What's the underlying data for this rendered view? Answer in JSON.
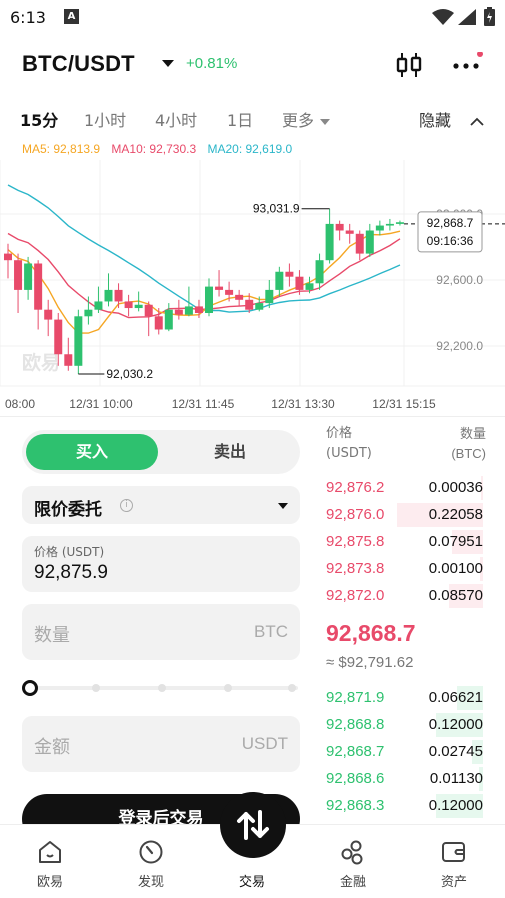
{
  "status_bar": {
    "time": "6:13",
    "app_badge": "A"
  },
  "header": {
    "pair": "BTC/USDT",
    "change": "+0.81%",
    "change_color": "#2ec16f"
  },
  "tabs": {
    "items": [
      "15分",
      "1小时",
      "4小时",
      "1日",
      "更多"
    ],
    "active": "15分",
    "hide_label": "隐藏"
  },
  "ma": {
    "ma5": "MA5: 92,813.9",
    "ma10": "MA10: 92,730.3",
    "ma20": "MA20: 92,619.0",
    "colors": {
      "ma5": "#f5a623",
      "ma10": "#e84a6a",
      "ma20": "#2bb6c9"
    }
  },
  "chart_data": {
    "type": "candlestick",
    "y_ticks": [
      "93,000.0",
      "92,600.0",
      "92,200.0"
    ],
    "x_ticks": [
      "08:00",
      "12/31 10:00",
      "12/31 11:45",
      "12/31 13:30",
      "12/31 15:15"
    ],
    "high_label": "93,031.9",
    "low_label": "92,030.2",
    "current_price": "92,868.7",
    "countdown": "09:16:36",
    "watermark": "欧易",
    "candles": [
      [
        92760,
        92720,
        92820,
        92610
      ],
      [
        92720,
        92540,
        92760,
        92400
      ],
      [
        92540,
        92700,
        92740,
        92480
      ],
      [
        92700,
        92420,
        92720,
        92300
      ],
      [
        92420,
        92360,
        92480,
        92260
      ],
      [
        92360,
        92150,
        92400,
        92080
      ],
      [
        92150,
        92080,
        92250,
        92050
      ],
      [
        92080,
        92380,
        92420,
        92030
      ],
      [
        92380,
        92420,
        92500,
        92330
      ],
      [
        92420,
        92470,
        92560,
        92400
      ],
      [
        92470,
        92540,
        92640,
        92440
      ],
      [
        92540,
        92470,
        92580,
        92430
      ],
      [
        92470,
        92430,
        92510,
        92380
      ],
      [
        92430,
        92450,
        92530,
        92410
      ],
      [
        92450,
        92380,
        92470,
        92260
      ],
      [
        92380,
        92300,
        92430,
        92270
      ],
      [
        92300,
        92420,
        92460,
        92290
      ],
      [
        92420,
        92390,
        92480,
        92360
      ],
      [
        92390,
        92440,
        92560,
        92380
      ],
      [
        92440,
        92400,
        92480,
        92370
      ],
      [
        92400,
        92560,
        92610,
        92380
      ],
      [
        92560,
        92540,
        92660,
        92500
      ],
      [
        92540,
        92510,
        92590,
        92470
      ],
      [
        92510,
        92480,
        92540,
        92440
      ],
      [
        92480,
        92420,
        92520,
        92400
      ],
      [
        92420,
        92460,
        92500,
        92410
      ],
      [
        92460,
        92540,
        92600,
        92430
      ],
      [
        92540,
        92650,
        92680,
        92500
      ],
      [
        92650,
        92620,
        92700,
        92560
      ],
      [
        92620,
        92540,
        92660,
        92510
      ],
      [
        92540,
        92580,
        92620,
        92520
      ],
      [
        92580,
        92720,
        92760,
        92540
      ],
      [
        92720,
        92940,
        93031.9,
        92700
      ],
      [
        92940,
        92900,
        92960,
        92840
      ],
      [
        92900,
        92880,
        92940,
        92820
      ],
      [
        92880,
        92760,
        92900,
        92720
      ],
      [
        92760,
        92900,
        92940,
        92740
      ],
      [
        92900,
        92930,
        92960,
        92870
      ],
      [
        92930,
        92940,
        92970,
        92900
      ],
      [
        92940,
        92950,
        92960,
        92930
      ]
    ]
  },
  "order_form": {
    "buy_label": "买入",
    "sell_label": "卖出",
    "order_type": "限价委托",
    "price_label": "价格 (USDT)",
    "price_value": "92,875.9",
    "qty_placeholder": "数量",
    "qty_unit": "BTC",
    "amount_placeholder": "金额",
    "amount_unit": "USDT",
    "login_label": "登录后交易"
  },
  "order_book": {
    "price_header": [
      "价格",
      "(USDT)"
    ],
    "qty_header": [
      "数量",
      "(BTC)"
    ],
    "asks": [
      {
        "price": "92,876.2",
        "qty": "0.00036",
        "depth": 0.02
      },
      {
        "price": "92,876.0",
        "qty": "0.22058",
        "depth": 1.0
      },
      {
        "price": "92,875.8",
        "qty": "0.07951",
        "depth": 0.36
      },
      {
        "price": "92,873.8",
        "qty": "0.00100",
        "depth": 0.03
      },
      {
        "price": "92,872.0",
        "qty": "0.08570",
        "depth": 0.39
      }
    ],
    "last_price": "92,868.7",
    "last_fiat": "≈ $92,791.62",
    "bids": [
      {
        "price": "92,871.9",
        "qty": "0.06621",
        "depth": 0.3
      },
      {
        "price": "92,868.8",
        "qty": "0.12000",
        "depth": 0.55
      },
      {
        "price": "92,868.7",
        "qty": "0.02745",
        "depth": 0.13
      },
      {
        "price": "92,868.6",
        "qty": "0.01130",
        "depth": 0.05
      },
      {
        "price": "92,868.3",
        "qty": "0.12000",
        "depth": 0.55
      }
    ]
  },
  "bottom_nav": {
    "items": [
      {
        "label": "欧易",
        "icon": "home-icon"
      },
      {
        "label": "发现",
        "icon": "discover-icon"
      },
      {
        "label": "交易",
        "icon": "trade-icon"
      },
      {
        "label": "金融",
        "icon": "finance-icon"
      },
      {
        "label": "资产",
        "icon": "wallet-icon"
      }
    ]
  }
}
